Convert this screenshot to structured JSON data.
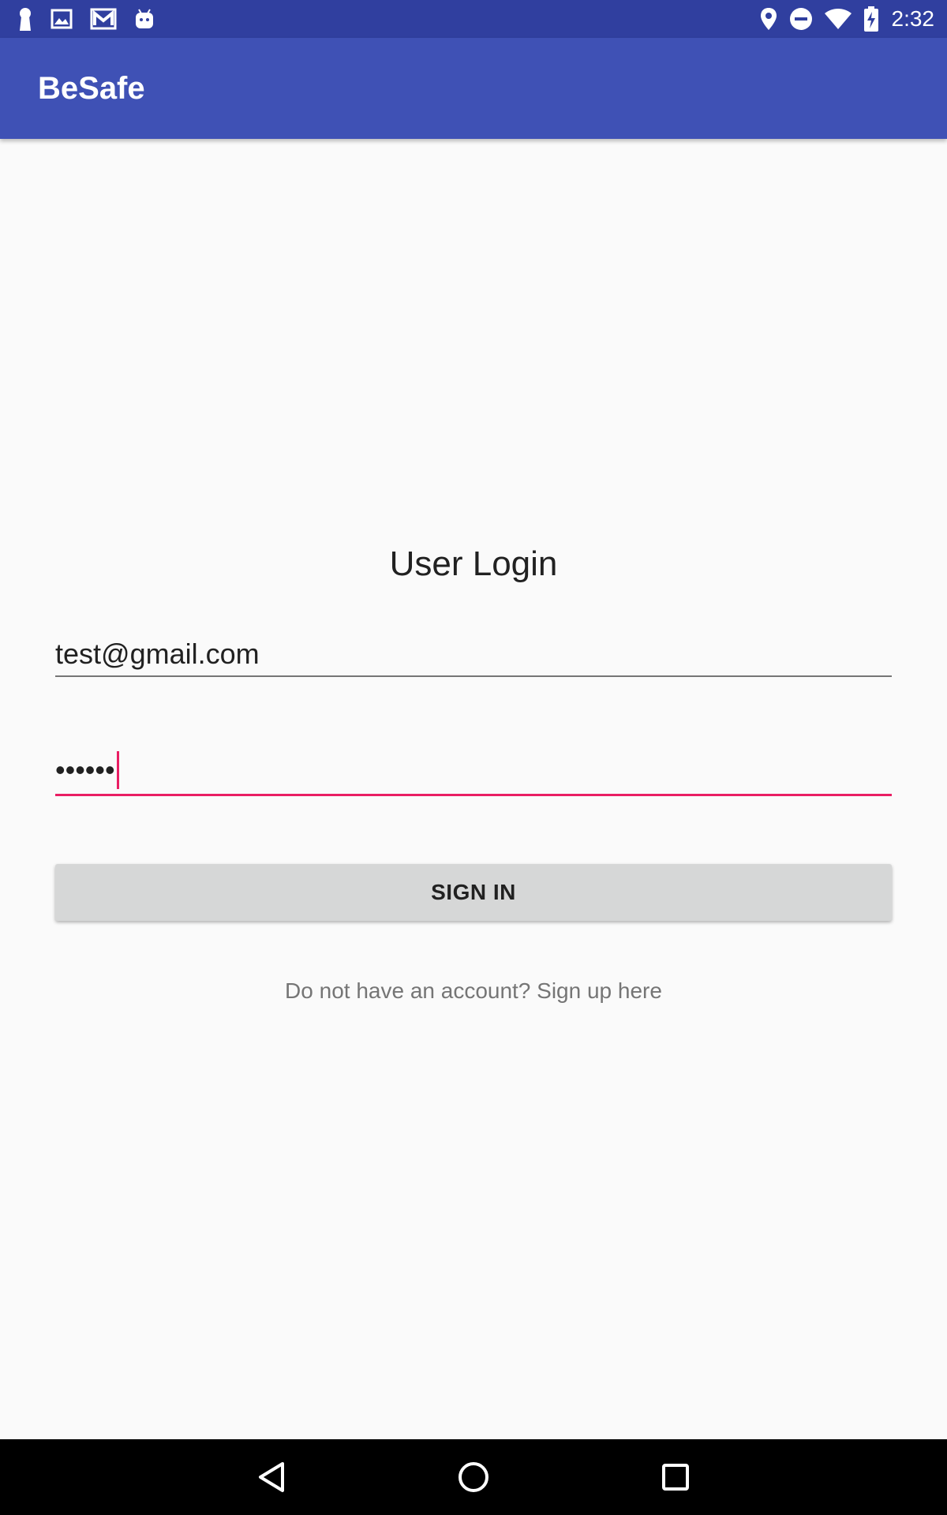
{
  "status_bar": {
    "time": "2:32",
    "left_icons": [
      "keyhole-icon",
      "image-icon",
      "gmail-icon",
      "android-icon"
    ],
    "right_icons": [
      "location-icon",
      "do-not-disturb-icon",
      "wifi-icon",
      "battery-charging-icon"
    ]
  },
  "app_bar": {
    "title": "BeSafe"
  },
  "login": {
    "title": "User Login",
    "email_value": "test@gmail.com",
    "password_value": "••••••",
    "signin_label": "SIGN IN",
    "signup_text": "Do not have an account? Sign up here"
  },
  "colors": {
    "status_bar": "#303f9f",
    "app_bar": "#3f51b5",
    "accent": "#e91e63",
    "background": "#fafafa",
    "button": "#d6d7d7"
  },
  "nav_bar": {
    "buttons": [
      "back-icon",
      "home-icon",
      "recents-icon"
    ]
  }
}
